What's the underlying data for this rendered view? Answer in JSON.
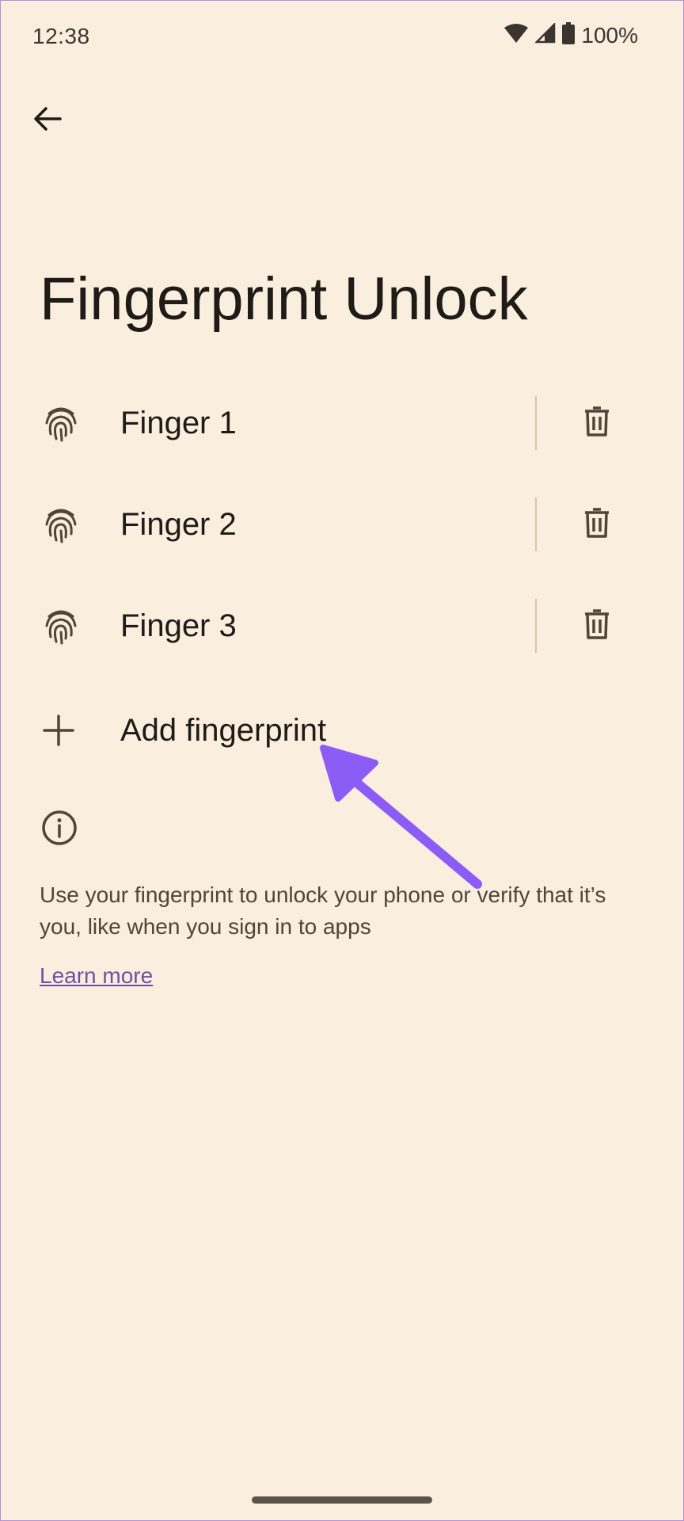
{
  "status_bar": {
    "time": "12:38",
    "battery_pct": "100%",
    "icons": [
      "wifi-icon",
      "cell-signal-icon",
      "battery-icon"
    ]
  },
  "header": {
    "back_icon": "arrow-back-icon",
    "title": "Fingerprint Unlock"
  },
  "fingerprints": [
    {
      "label": "Finger 1",
      "icon": "fingerprint-icon",
      "action_icon": "trash-icon"
    },
    {
      "label": "Finger 2",
      "icon": "fingerprint-icon",
      "action_icon": "trash-icon"
    },
    {
      "label": "Finger 3",
      "icon": "fingerprint-icon",
      "action_icon": "trash-icon"
    }
  ],
  "add_row": {
    "icon": "plus-icon",
    "label": "Add fingerprint"
  },
  "info": {
    "icon": "info-icon",
    "text": "Use your fingerprint to unlock your phone or verify that it’s you, like when you sign in to apps",
    "link": "Learn more"
  },
  "colors": {
    "background": "#faeede",
    "text": "#1f1b16",
    "link": "#6f4fa6",
    "annotation_arrow": "#8b5cf6"
  }
}
